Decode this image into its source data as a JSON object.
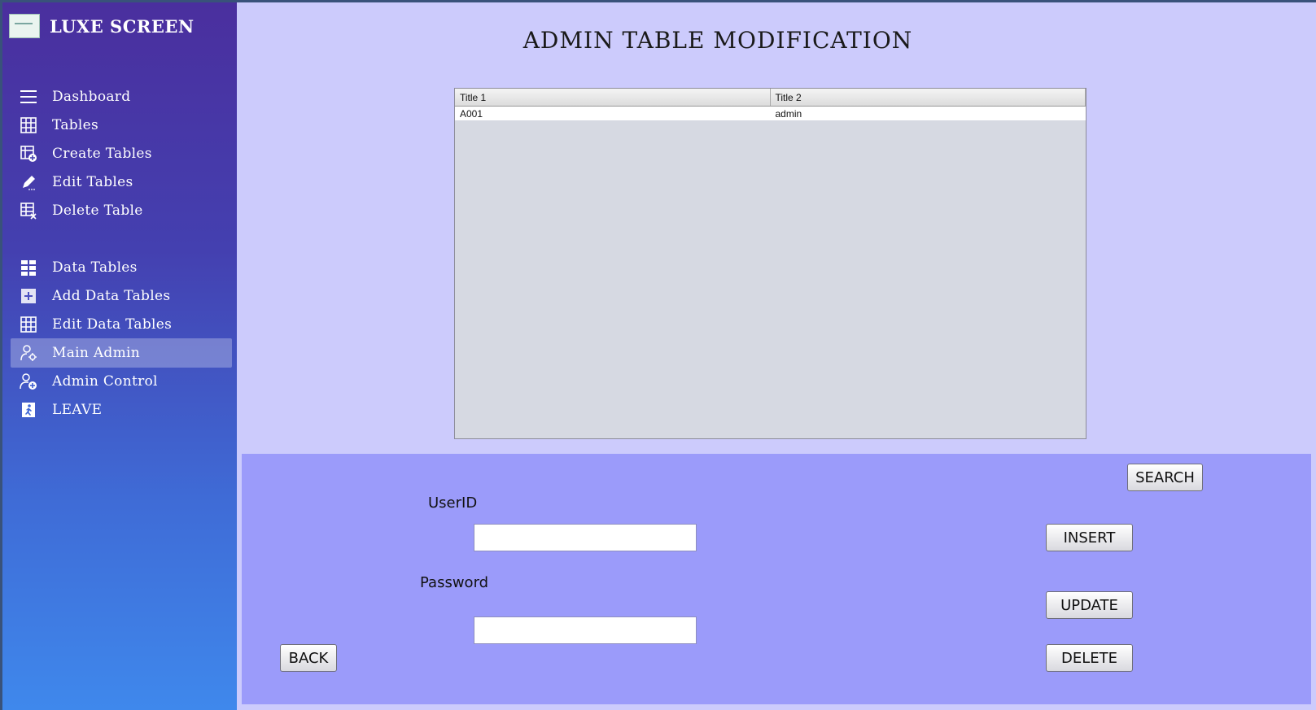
{
  "app": {
    "name": "LUXE SCREEN"
  },
  "sidebar": {
    "items": [
      {
        "label": "Dashboard",
        "icon": "menu-icon"
      },
      {
        "label": "Tables",
        "icon": "grid-icon"
      },
      {
        "label": "Create Tables",
        "icon": "table-add-icon"
      },
      {
        "label": "Edit Tables",
        "icon": "pencil-icon"
      },
      {
        "label": "Delete Table",
        "icon": "table-delete-icon"
      },
      {
        "label": "Data Tables",
        "icon": "data-grid-icon"
      },
      {
        "label": "Add Data Tables",
        "icon": "plus-box-icon"
      },
      {
        "label": "Edit Data Tables",
        "icon": "grid-icon"
      },
      {
        "label": "Main Admin",
        "icon": "user-gear-icon",
        "active": true
      },
      {
        "label": "Admin Control",
        "icon": "user-add-icon"
      },
      {
        "label": "LEAVE",
        "icon": "exit-icon"
      }
    ]
  },
  "main": {
    "title": "ADMIN TABLE MODIFICATION",
    "table": {
      "columns": [
        "Title 1",
        "Title 2"
      ],
      "rows": [
        [
          "A001",
          "admin"
        ]
      ]
    }
  },
  "form": {
    "userid_label": "UserID",
    "userid_value": "",
    "password_label": "Password",
    "password_value": ""
  },
  "buttons": {
    "search": "SEARCH",
    "insert": "INSERT",
    "update": "UPDATE",
    "delete": "DELETE",
    "back": "BACK"
  },
  "colors": {
    "sidebar_top": "#4a2f9e",
    "sidebar_bottom": "#3f88ec",
    "main_bg": "#cccbfc",
    "panel_bg": "#9b9bfa"
  }
}
